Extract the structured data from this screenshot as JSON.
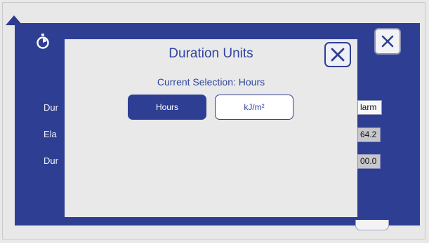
{
  "background": {
    "labels": [
      "Dur",
      "Ela",
      "Dur"
    ],
    "values": [
      "larm",
      "64.2",
      "00.0"
    ],
    "close_icon": "close-icon",
    "timer_icon": "stopwatch-icon"
  },
  "modal": {
    "title": "Duration Units",
    "current_selection": "Current Selection: Hours",
    "options": [
      {
        "label": "Hours",
        "selected": true
      },
      {
        "label": "kJ/m²",
        "selected": false
      }
    ],
    "close_icon": "close-icon"
  },
  "colors": {
    "panel_blue": "#2e3f93",
    "accent_text": "#2f44a0",
    "modal_bg": "#e9e9ea"
  }
}
